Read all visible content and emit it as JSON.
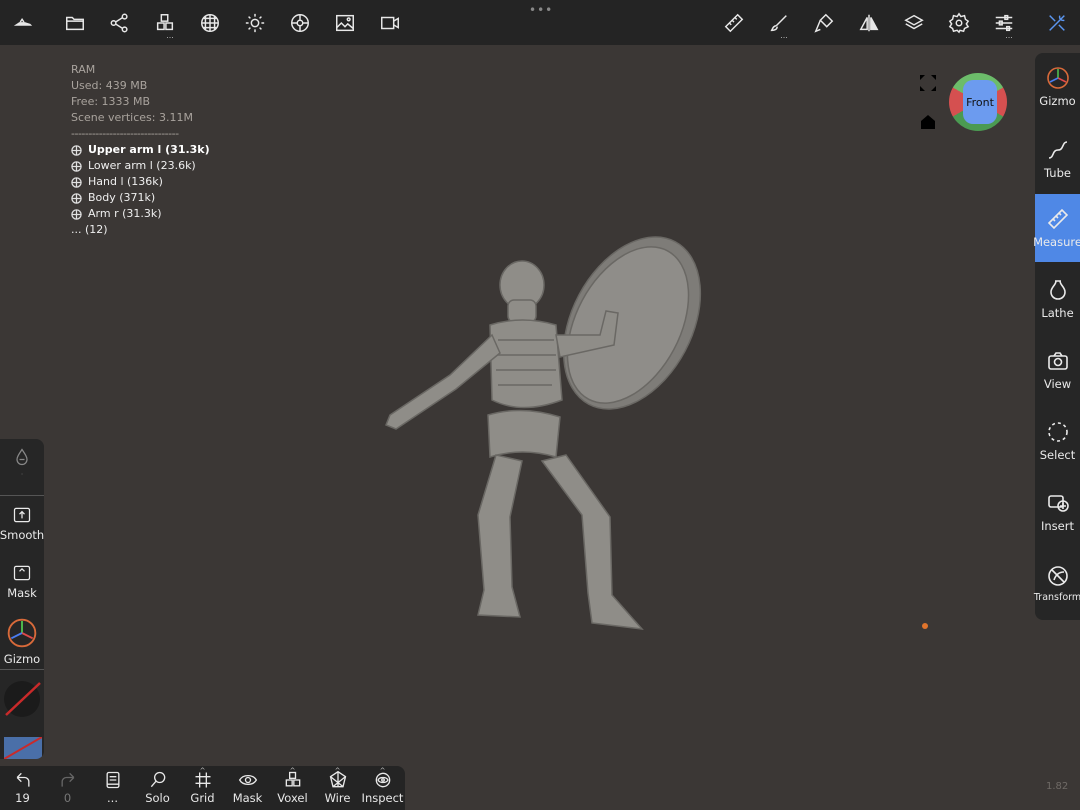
{
  "top_toolbar": {
    "left_icons": [
      "boat-logo-icon",
      "folder-icon",
      "scene-graph-icon",
      "voxel-cubes-icon",
      "sphere-grid-icon",
      "sun-icon",
      "material-ball-icon",
      "image-icon",
      "video-camera-icon"
    ],
    "right_icons": [
      "ruler-icon",
      "brush-icon",
      "paint-tool-icon",
      "symmetry-icon",
      "layers-icon",
      "settings-gear-icon",
      "sliders-icon",
      "tools-icon"
    ],
    "more_indicator": "..."
  },
  "stats": {
    "ram": "RAM",
    "used": "Used: 439 MB",
    "free": "Free: 1333 MB",
    "vertices": "Scene vertices: 3.11M",
    "separator": "-------------------------------",
    "objects": [
      "Upper arm l (31.3k)",
      "Lower arm l (23.6k)",
      "Hand l (136k)",
      "Body (371k)",
      "Arm r (31.3k)"
    ],
    "more": "... (12)"
  },
  "viewcube": {
    "face": "Front"
  },
  "right_panel": {
    "items": [
      {
        "label": "Gizmo"
      },
      {
        "label": "Tube"
      },
      {
        "label": "Measure"
      },
      {
        "label": "Lathe"
      },
      {
        "label": "View"
      },
      {
        "label": "Select"
      },
      {
        "label": "Insert"
      },
      {
        "label": "Transform"
      }
    ],
    "active": "Measure",
    "active_color": "#4f88e6"
  },
  "left_panel": {
    "items": [
      {
        "label": "Smooth"
      },
      {
        "label": "Mask"
      },
      {
        "label": "Gizmo"
      }
    ]
  },
  "bottom_toolbar": {
    "undo_count": "19",
    "redo_count": "0",
    "items": [
      {
        "label": "..."
      },
      {
        "label": "Solo"
      },
      {
        "label": "Grid"
      },
      {
        "label": "Mask"
      },
      {
        "label": "Voxel"
      },
      {
        "label": "Wire"
      },
      {
        "label": "Inspect"
      }
    ]
  },
  "version": "1.82"
}
